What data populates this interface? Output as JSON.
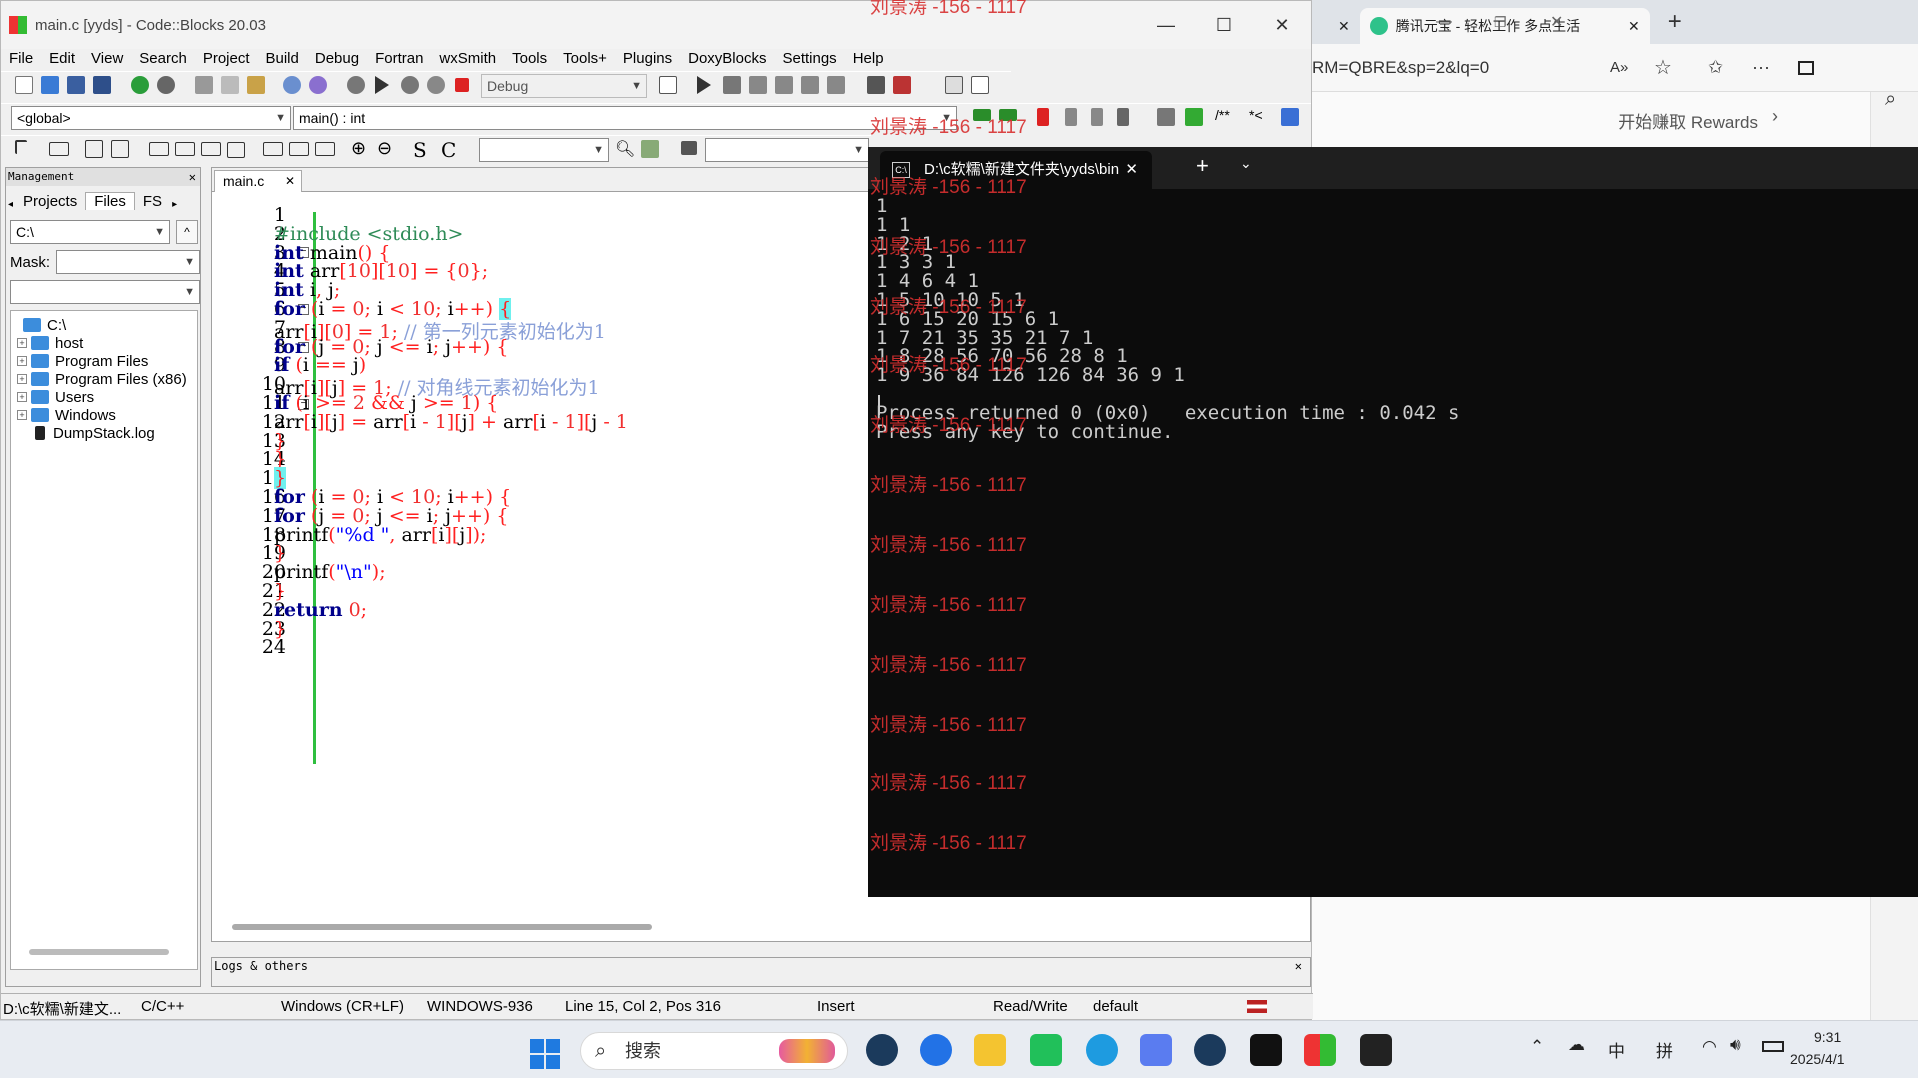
{
  "codeblocks": {
    "title": "main.c [yyds] - Code::Blocks 20.03",
    "menu": [
      "File",
      "Edit",
      "View",
      "Search",
      "Project",
      "Build",
      "Debug",
      "Fortran",
      "wxSmith",
      "Tools",
      "Tools+",
      "Plugins",
      "DoxyBlocks",
      "Settings",
      "Help"
    ],
    "build_target": "Debug",
    "scope": "<global>",
    "function": "main() : int",
    "management": {
      "header": "Management",
      "tabs": [
        "Projects",
        "Files",
        "FS"
      ],
      "drive": "C:\\",
      "mask_label": "Mask:",
      "tree": [
        "C:\\",
        "host",
        "Program Files",
        "Program Files (x86)",
        "Users",
        "Windows",
        "DumpStack.log"
      ]
    },
    "editor": {
      "tab": "main.c",
      "line_numbers": [
        "1",
        "2",
        "3",
        "4",
        "5",
        "6",
        "7",
        "8",
        "9",
        "10",
        "11",
        "12",
        "13",
        "14",
        "15",
        "16",
        "17",
        "18",
        "19",
        "20",
        "21",
        "22",
        "23",
        "24"
      ]
    },
    "logs_title": "Logs & others",
    "status": {
      "path": "D:\\c软糯\\新建文...",
      "lang": "C/C++",
      "eol": "Windows (CR+LF)",
      "encoding": "WINDOWS-936",
      "position": "Line 15, Col 2, Pos 316",
      "mode": "Insert",
      "access": "Read/Write",
      "theme": "default"
    }
  },
  "terminal": {
    "tab_title": "D:\\c软糯\\新建文件夹\\yyds\\bin",
    "lines": [
      "1",
      "1 1",
      "1 2 1",
      "1 3 3 1",
      "1 4 6 4 1",
      "1 5 10 10 5 1",
      "1 6 15 20 15 6 1",
      "1 7 21 35 35 21 7 1",
      "1 8 28 56 70 56 28 8 1",
      "1 9 36 84 126 126 84 36 9 1",
      "",
      "Process returned 0 (0x0)   execution time : 0.042 s",
      "Press any key to continue."
    ]
  },
  "watermark": "刘景涛 -156 - 1117",
  "edge": {
    "tab1_close": "✕",
    "tab2_title": "腾讯元宝 - 轻松工作 多点生活",
    "url": "RM=QBRE&sp=2&lq=0",
    "rewards": "开始赚取 Rewards"
  },
  "taskbar": {
    "search": "搜索",
    "ime1": "中",
    "ime2": "拼",
    "time": "9:31",
    "date": "2025/4/1"
  },
  "colors": {
    "keyword": "#00008b",
    "number": "#f03030",
    "comment": "#8aa0d8",
    "terminal_bg": "#0c0c0c",
    "watermark": "#d83030"
  }
}
